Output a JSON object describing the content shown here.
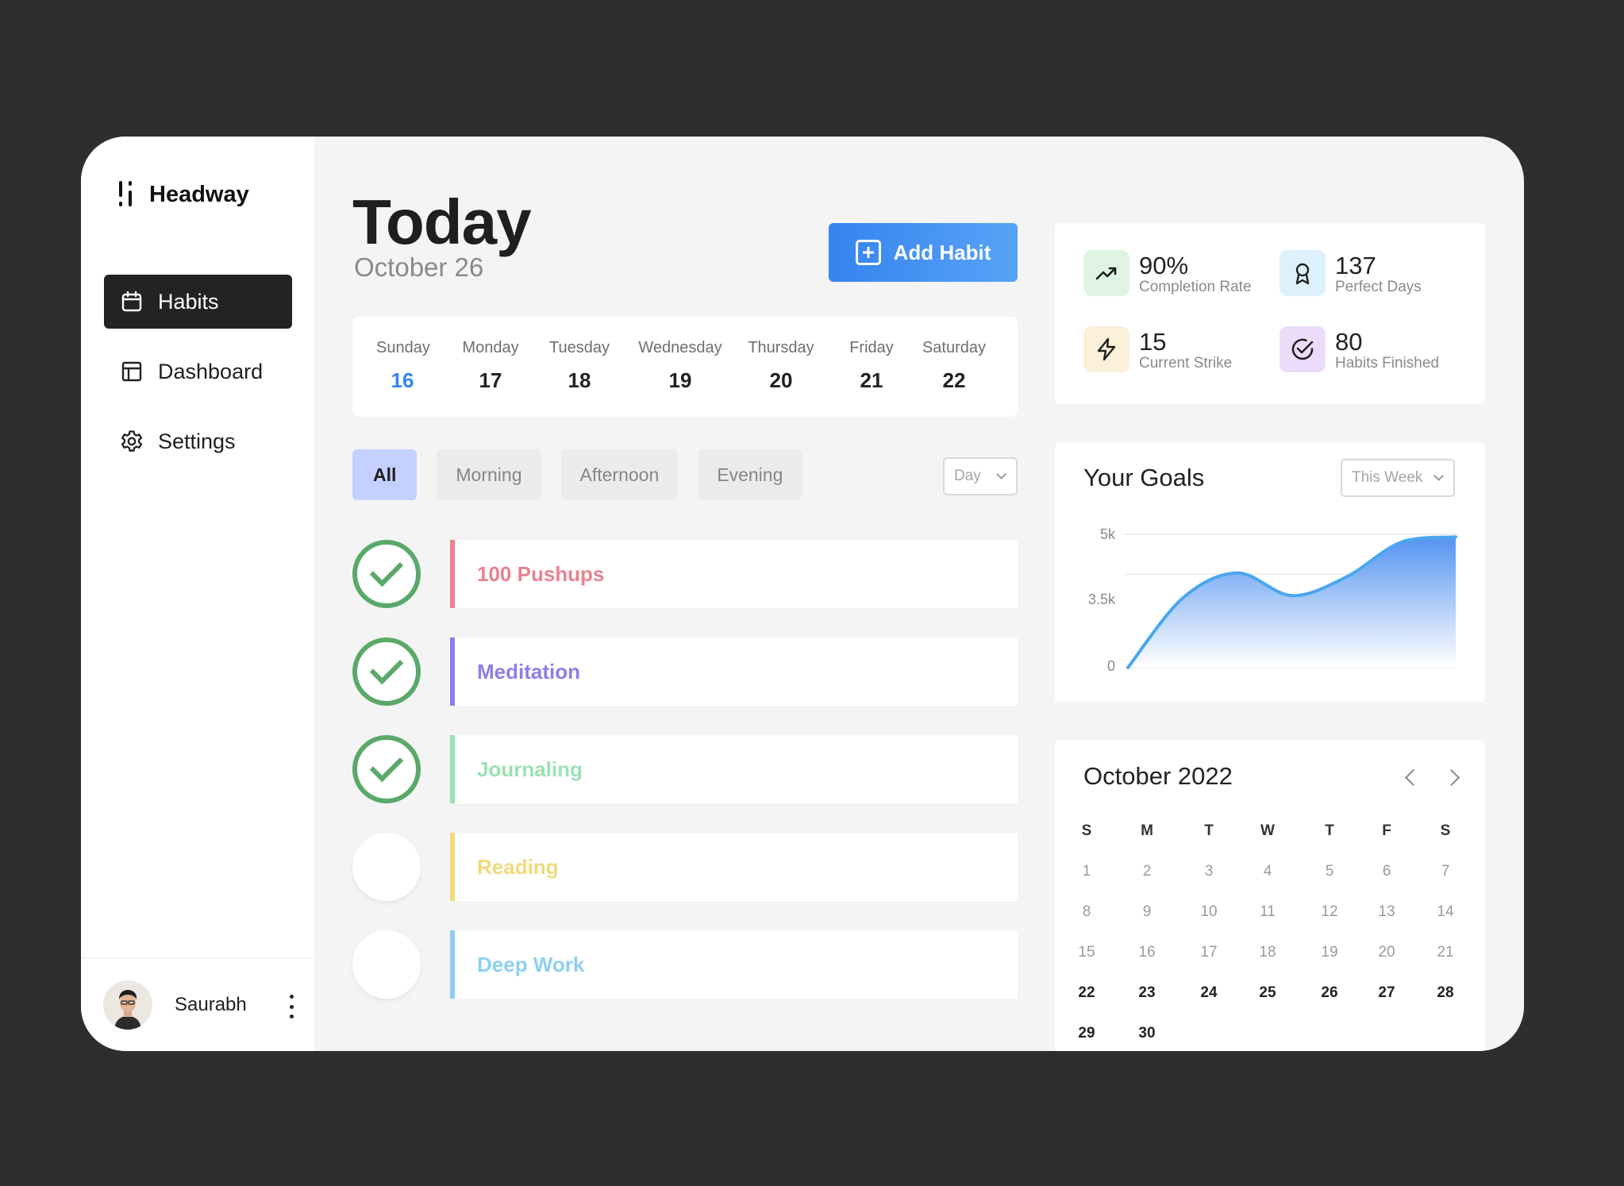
{
  "app": {
    "name": "Headway"
  },
  "sidebar": {
    "items": [
      {
        "label": "Habits",
        "icon": "calendar-icon",
        "active": true
      },
      {
        "label": "Dashboard",
        "icon": "layout-icon",
        "active": false
      },
      {
        "label": "Settings",
        "icon": "gear-icon",
        "active": false
      }
    ],
    "user": {
      "name": "Saurabh"
    }
  },
  "header": {
    "title": "Today",
    "date": "October 26",
    "add_label": "Add Habit"
  },
  "week": [
    {
      "name": "Sunday",
      "num": "16",
      "active": true
    },
    {
      "name": "Monday",
      "num": "17"
    },
    {
      "name": "Tuesday",
      "num": "18"
    },
    {
      "name": "Wednesday",
      "num": "19"
    },
    {
      "name": "Thursday",
      "num": "20"
    },
    {
      "name": "Friday",
      "num": "21"
    },
    {
      "name": "Saturday",
      "num": "22"
    }
  ],
  "filters": {
    "tabs": [
      "All",
      "Morning",
      "Afternoon",
      "Evening"
    ],
    "active": "All",
    "range": "Day"
  },
  "habits": [
    {
      "name": "100 Pushups",
      "done": true,
      "color": "#e8828f"
    },
    {
      "name": "Meditation",
      "done": true,
      "color": "#8d7ee6"
    },
    {
      "name": "Journaling",
      "done": true,
      "color": "#9be2b2"
    },
    {
      "name": "Reading",
      "done": false,
      "color": "#f2d97a"
    },
    {
      "name": "Deep Work",
      "done": false,
      "color": "#8fcff0"
    }
  ],
  "stats": [
    {
      "value": "90%",
      "label": "Completion Rate",
      "icon": "trending-up-icon",
      "bg": "#dff5e2"
    },
    {
      "value": "137",
      "label": "Perfect Days",
      "icon": "award-icon",
      "bg": "#dcf1fb"
    },
    {
      "value": "15",
      "label": "Current Strike",
      "icon": "lightning-icon",
      "bg": "#fbf0d8"
    },
    {
      "value": "80",
      "label": "Habits Finished",
      "icon": "check-circle-icon",
      "bg": "#ecdcfa"
    }
  ],
  "goals": {
    "title": "Your Goals",
    "range": "This Week",
    "y_ticks": [
      "5k",
      "3.5k",
      "0"
    ]
  },
  "chart_data": {
    "type": "area",
    "title": "Your Goals",
    "x": [
      0,
      1,
      2,
      3,
      4,
      5,
      6
    ],
    "values": [
      0,
      2600,
      3550,
      2700,
      3400,
      4700,
      4900
    ],
    "ylim": [
      0,
      5000
    ],
    "y_ticks": [
      "5k",
      "3.5k",
      "0"
    ],
    "colors": {
      "line": "#4aa7ee",
      "fill_top": "#4a8df0",
      "fill_bottom": "#ffffff"
    }
  },
  "calendar": {
    "title": "October 2022",
    "weekdays": [
      "S",
      "M",
      "T",
      "W",
      "T",
      "F",
      "S"
    ],
    "days": [
      "1",
      "2",
      "3",
      "4",
      "5",
      "6",
      "7",
      "8",
      "9",
      "10",
      "11",
      "12",
      "13",
      "14",
      "15",
      "16",
      "17",
      "18",
      "19",
      "20",
      "21",
      "22",
      "23",
      "24",
      "25",
      "26",
      "27",
      "28",
      "29",
      "30"
    ],
    "strong_from": 22
  },
  "colors": {
    "accent": "#3584f0",
    "success": "#5aa96a"
  }
}
